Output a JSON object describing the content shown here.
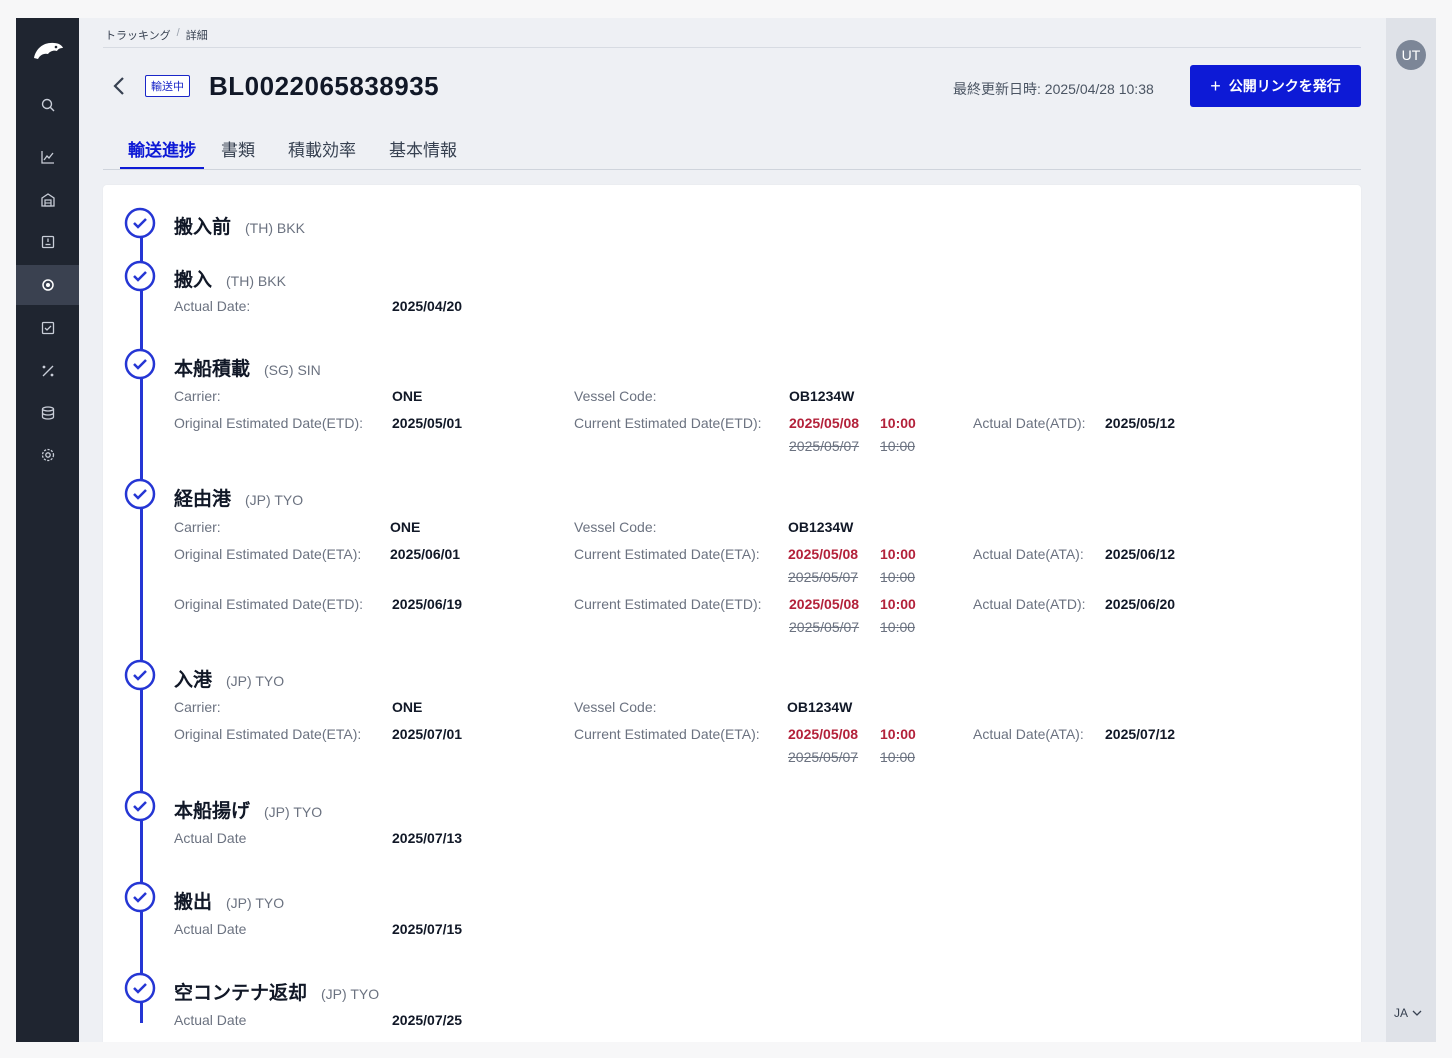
{
  "breadcrumb": {
    "parent": "トラッキング",
    "separator": "/",
    "current": "詳細"
  },
  "header": {
    "status": "輸送中",
    "bl_number": "BL0022065838935",
    "updated_label": "最終更新日時: 2025/04/28 10:38",
    "publish_plus": "+",
    "publish_label": "公開リンクを発行"
  },
  "tabs": [
    {
      "label": "輸送進捗",
      "active": true
    },
    {
      "label": "書類"
    },
    {
      "label": "積載効率"
    },
    {
      "label": "基本情報"
    }
  ],
  "user": {
    "initials": "UT",
    "language": "JA"
  },
  "sidebar_icons": [
    "logo-icon",
    "search-icon",
    "chart-icon",
    "warehouse-icon",
    "document-icon",
    "tracking-icon",
    "checklist-icon",
    "percent-icon",
    "database-icon",
    "settings-icon"
  ],
  "steps": [
    {
      "title": "搬入前",
      "loc": "(TH) BKK"
    },
    {
      "title": "搬入",
      "loc": "(TH) BKK",
      "rows": [
        {
          "l1": "Actual Date:",
          "v1": "2025/04/20"
        }
      ]
    },
    {
      "title": "本船積載",
      "loc": "(SG) SIN",
      "carrier_label": "Carrier:",
      "carrier": "ONE",
      "vessel_label": "Vessel Code:",
      "vessel": "OB1234W",
      "orig_label": "Original Estimated Date(ETD):",
      "orig": "2025/05/01",
      "cur_label": "Current Estimated Date(ETD):",
      "cur_date": "2025/05/08",
      "cur_time": "10:00",
      "old_date": "2025/05/07",
      "old_time": "10:00",
      "act_label": "Actual Date(ATD):",
      "act": "2025/05/12"
    },
    {
      "title": "経由港",
      "loc": "(JP) TYO",
      "carrier_label": "Carrier:",
      "carrier": "ONE",
      "vessel_label": "Vessel Code:",
      "vessel": "OB1234W",
      "orig_label": "Original Estimated Date(ETA):",
      "orig": "2025/06/01",
      "cur_label": "Current Estimated Date(ETA):",
      "cur_date": "2025/05/08",
      "cur_time": "10:00",
      "old_date": "2025/05/07",
      "old_time": "10:00",
      "act_label": "Actual Date(ATA):",
      "act": "2025/06/12",
      "orig2_label": "Original Estimated Date(ETD):",
      "orig2": "2025/06/19",
      "cur2_label": "Current Estimated Date(ETD):",
      "cur2_date": "2025/05/08",
      "cur2_time": "10:00",
      "old2_date": "2025/05/07",
      "old2_time": "10:00",
      "act2_label": "Actual Date(ATD):",
      "act2": "2025/06/20"
    },
    {
      "title": "入港",
      "loc": "(JP) TYO",
      "carrier_label": "Carrier:",
      "carrier": "ONE",
      "vessel_label": "Vessel Code:",
      "vessel": "OB1234W",
      "orig_label": "Original Estimated Date(ETA):",
      "orig": "2025/07/01",
      "cur_label": "Current Estimated Date(ETA):",
      "cur_date": "2025/05/08",
      "cur_time": "10:00",
      "old_date": "2025/05/07",
      "old_time": "10:00",
      "act_label": "Actual Date(ATA):",
      "act": "2025/07/12"
    },
    {
      "title": "本船揚げ",
      "loc": "(JP) TYO",
      "rows": [
        {
          "l1": "Actual Date",
          "v1": "2025/07/13"
        }
      ]
    },
    {
      "title": "搬出",
      "loc": "(JP) TYO",
      "rows": [
        {
          "l1": "Actual Date",
          "v1": "2025/07/15"
        }
      ]
    },
    {
      "title": "空コンテナ返却",
      "loc": "(JP) TYO",
      "rows": [
        {
          "l1": "Actual Date",
          "v1": "2025/07/25"
        }
      ]
    }
  ],
  "colors": {
    "accent": "#0d1ad6",
    "timeline": "#2536d4",
    "changed": "#b3213a",
    "sidebar": "#1f2530"
  }
}
